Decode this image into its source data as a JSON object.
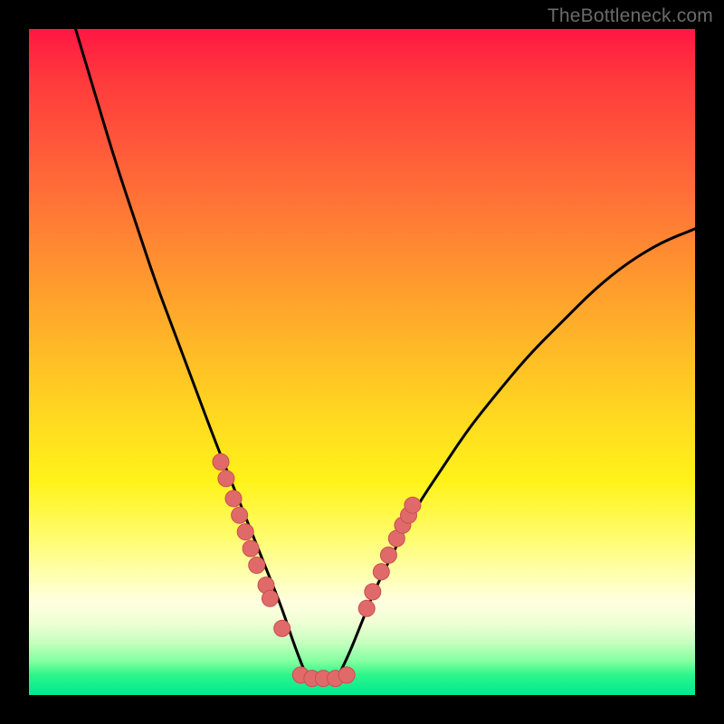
{
  "watermark": "TheBottleneck.com",
  "colors": {
    "curve": "#000000",
    "marker_fill": "#e06a6a",
    "marker_stroke": "#c94f4f"
  },
  "chart_data": {
    "type": "line",
    "title": "",
    "xlabel": "",
    "ylabel": "",
    "xlim": [
      0,
      100
    ],
    "ylim": [
      0,
      100
    ],
    "grid": false,
    "curve": {
      "name": "bottleneck-curve",
      "description": "V-shaped bottleneck curve; minimum near x≈42 at y≈2",
      "x": [
        7,
        10,
        13,
        16,
        19,
        22,
        25,
        28,
        30,
        32,
        34,
        36,
        38,
        40,
        42,
        44,
        46,
        48,
        50,
        52,
        55,
        58,
        62,
        66,
        70,
        75,
        80,
        85,
        90,
        95,
        100
      ],
      "y": [
        100,
        90,
        80,
        71,
        62,
        54,
        46,
        38,
        33,
        28,
        23,
        18,
        13,
        7,
        2,
        2,
        2,
        6,
        11,
        16,
        22,
        28,
        34,
        40,
        45,
        51,
        56,
        61,
        65,
        68,
        70
      ]
    },
    "markers": {
      "name": "highlight-points",
      "x": [
        28.8,
        29.6,
        30.7,
        31.6,
        32.5,
        33.3,
        34.2,
        35.6,
        36.2,
        38.0,
        40.8,
        42.5,
        44.2,
        46.0,
        47.7,
        50.7,
        51.6,
        52.9,
        54.0,
        55.2,
        56.1,
        57.0,
        57.6
      ],
      "y": [
        35.0,
        32.5,
        29.5,
        27.0,
        24.5,
        22.0,
        19.5,
        16.5,
        14.5,
        10.0,
        3.0,
        2.5,
        2.5,
        2.5,
        3.0,
        13.0,
        15.5,
        18.5,
        21.0,
        23.5,
        25.5,
        27.0,
        28.5
      ]
    }
  }
}
